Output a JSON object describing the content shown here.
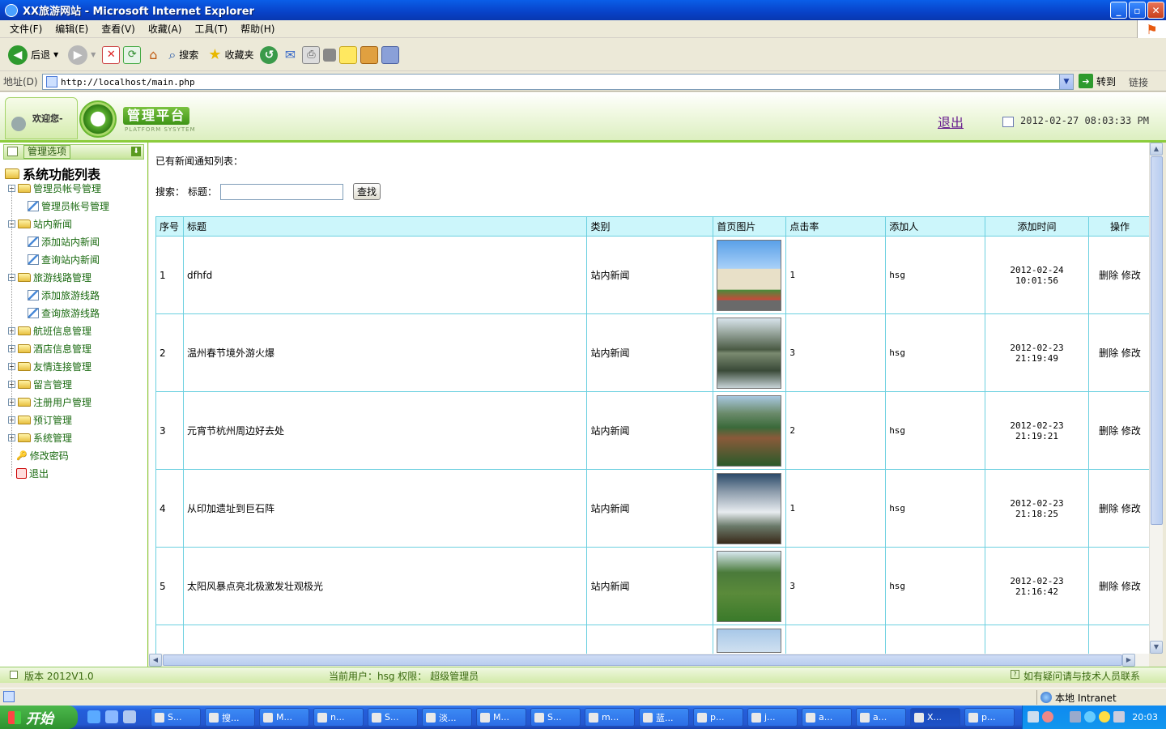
{
  "window": {
    "title": "XX旅游网站 - Microsoft Internet Explorer",
    "btn_min": "_",
    "btn_max": "▫",
    "btn_close": "✕"
  },
  "menu": [
    "文件(F)",
    "编辑(E)",
    "查看(V)",
    "收藏(A)",
    "工具(T)",
    "帮助(H)"
  ],
  "toolbar": {
    "back": "后退",
    "search": "搜索",
    "favorites": "收藏夹"
  },
  "address": {
    "label": "地址(D)",
    "url": "http://localhost/main.php",
    "go": "转到",
    "links": "链接"
  },
  "header": {
    "welcome": "欢迎您-",
    "logo_title": "管理平台",
    "logo_sub": "PLATFORM SYSYTEM",
    "logout": "退出",
    "datetime": "2012-02-27 08:03:33 PM"
  },
  "sidebar": {
    "title": "管理选项",
    "root": "系统功能列表",
    "items": [
      {
        "label": "管理员帐号管理",
        "open": true,
        "children": [
          "管理员帐号管理"
        ]
      },
      {
        "label": "站内新闻",
        "open": true,
        "children": [
          "添加站内新闻",
          "查询站内新闻"
        ]
      },
      {
        "label": "旅游线路管理",
        "open": true,
        "children": [
          "添加旅游线路",
          "查询旅游线路"
        ]
      },
      {
        "label": "航班信息管理",
        "open": false
      },
      {
        "label": "酒店信息管理",
        "open": false
      },
      {
        "label": "友情连接管理",
        "open": false
      },
      {
        "label": "留言管理",
        "open": false
      },
      {
        "label": "注册用户管理",
        "open": false
      },
      {
        "label": "预订管理",
        "open": false
      },
      {
        "label": "系统管理",
        "open": false
      }
    ],
    "change_password": "修改密码",
    "exit": "退出"
  },
  "main": {
    "heading": "已有新闻通知列表：",
    "search_label": "搜索：",
    "title_label": "标题：",
    "search_value": "",
    "search_button": "查找",
    "columns": [
      "序号",
      "标题",
      "类别",
      "首页图片",
      "点击率",
      "添加人",
      "添加时间",
      "操作"
    ],
    "delete_label": "删除",
    "edit_label": "修改",
    "rows": [
      {
        "id": "1",
        "title": "dfhfd",
        "category": "站内新闻",
        "image": "tower",
        "clicks": "1",
        "author": "hsg",
        "time": "2012-02-24 10:01:56"
      },
      {
        "id": "2",
        "title": "温州春节境外游火爆",
        "category": "站内新闻",
        "image": "lake",
        "clicks": "3",
        "author": "hsg",
        "time": "2012-02-23 21:19:49"
      },
      {
        "id": "3",
        "title": "元宵节杭州周边好去处",
        "category": "站内新闻",
        "image": "valley",
        "clicks": "2",
        "author": "hsg",
        "time": "2012-02-23 21:19:21"
      },
      {
        "id": "4",
        "title": "从印加遗址到巨石阵",
        "category": "站内新闻",
        "image": "clouds",
        "clicks": "1",
        "author": "hsg",
        "time": "2012-02-23 21:18:25"
      },
      {
        "id": "5",
        "title": "太阳风暴点亮北极激发壮观极光",
        "category": "站内新闻",
        "image": "park",
        "clicks": "3",
        "author": "hsg",
        "time": "2012-02-23 21:16:42"
      },
      {
        "id": "",
        "title": "",
        "category": "",
        "image": "sky",
        "clicks": "",
        "author": "",
        "time": ""
      }
    ]
  },
  "footer": {
    "version": "版本 2012V1.0",
    "current_user": "当前用户：hsg 权限： 超级管理员",
    "help": "如有疑问请与技术人员联系"
  },
  "statusbar": {
    "zone": "本地 Intranet"
  },
  "taskbar": {
    "start": "开始",
    "tasks": [
      "S...",
      "搜...",
      "M...",
      "n...",
      "S...",
      "淡...",
      "M...",
      "S...",
      "m...",
      "蓝...",
      "p...",
      "j...",
      "a...",
      "a...",
      "X...",
      "p..."
    ],
    "active_task": 14,
    "clock": "20:03"
  }
}
